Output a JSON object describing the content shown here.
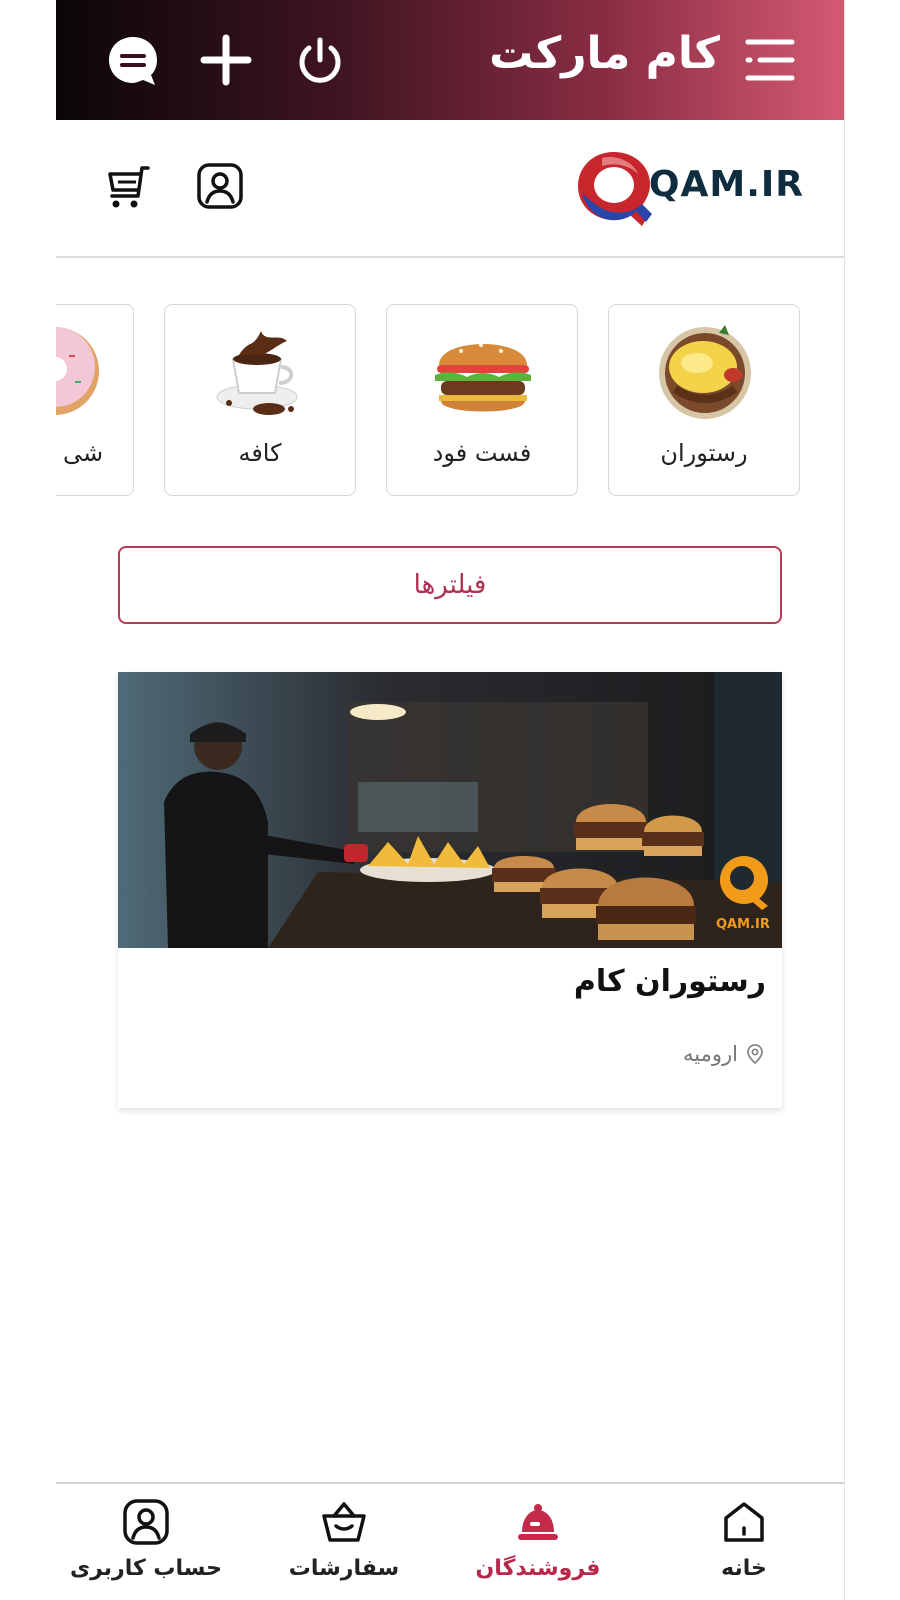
{
  "header": {
    "title": "کام مارکت",
    "icons": [
      "menu-icon",
      "power-icon",
      "plus-icon",
      "chat-icon"
    ],
    "gradient": [
      "#0b0608",
      "#d45a72"
    ]
  },
  "brand": {
    "logo_text": "QAM.IR"
  },
  "toolbar": {
    "icons": [
      "profile-icon",
      "cart-icon"
    ]
  },
  "categories": [
    {
      "label": "رستوران",
      "icon": "rice-plate-image"
    },
    {
      "label": "فست فود",
      "icon": "burger-image"
    },
    {
      "label": "کافه",
      "icon": "coffee-cup-image"
    },
    {
      "label": "شی",
      "icon": "donut-image"
    }
  ],
  "filters": {
    "label": "فیلترها"
  },
  "restaurant": {
    "name": "رستوران کام",
    "location": "ارومیه",
    "watermark": "QAM.IR"
  },
  "bottom_nav": {
    "items": [
      {
        "label": "خانه",
        "icon": "home-icon",
        "active": false
      },
      {
        "label": "فروشندگان",
        "icon": "sellers-icon",
        "active": true
      },
      {
        "label": "سفارشات",
        "icon": "orders-basket-icon",
        "active": false
      },
      {
        "label": "حساب کاربری",
        "icon": "account-icon",
        "active": false
      }
    ]
  },
  "colors": {
    "accent": "#b8284a",
    "border": "#d6d6d6"
  }
}
